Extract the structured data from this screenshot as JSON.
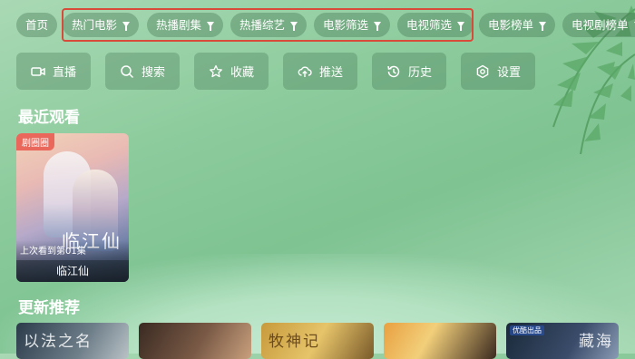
{
  "nav": {
    "tabs": [
      {
        "label": "首页",
        "filter": false
      },
      {
        "label": "热门电影",
        "filter": true
      },
      {
        "label": "热播剧集",
        "filter": true
      },
      {
        "label": "热播综艺",
        "filter": true
      },
      {
        "label": "电影筛选",
        "filter": true
      },
      {
        "label": "电视筛选",
        "filter": true
      },
      {
        "label": "电影榜单",
        "filter": true
      },
      {
        "label": "电视剧榜单",
        "filter": true
      }
    ]
  },
  "actions": [
    {
      "label": "直播",
      "icon": "live-camera-icon"
    },
    {
      "label": "搜索",
      "icon": "search-icon"
    },
    {
      "label": "收藏",
      "icon": "star-icon"
    },
    {
      "label": "推送",
      "icon": "upload-cloud-icon"
    },
    {
      "label": "历史",
      "icon": "history-icon"
    },
    {
      "label": "设置",
      "icon": "settings-icon"
    }
  ],
  "recent": {
    "title": "最近观看",
    "items": [
      {
        "badge": "剧圈圈",
        "poster_text": "临江仙",
        "progress_text": "上次看到第01集",
        "name": "临江仙"
      }
    ]
  },
  "recommend": {
    "title": "更新推荐",
    "items": [
      {
        "tag": "",
        "text": "以法之名"
      },
      {
        "tag": "",
        "text": ""
      },
      {
        "tag": "",
        "text": "牧神记"
      },
      {
        "tag": "",
        "text": ""
      },
      {
        "tag": "优酷出品",
        "text": "藏海"
      }
    ]
  },
  "colors": {
    "highlight_border": "#d84a3a",
    "badge": "#e9685b",
    "background": "#8ccb9c"
  }
}
